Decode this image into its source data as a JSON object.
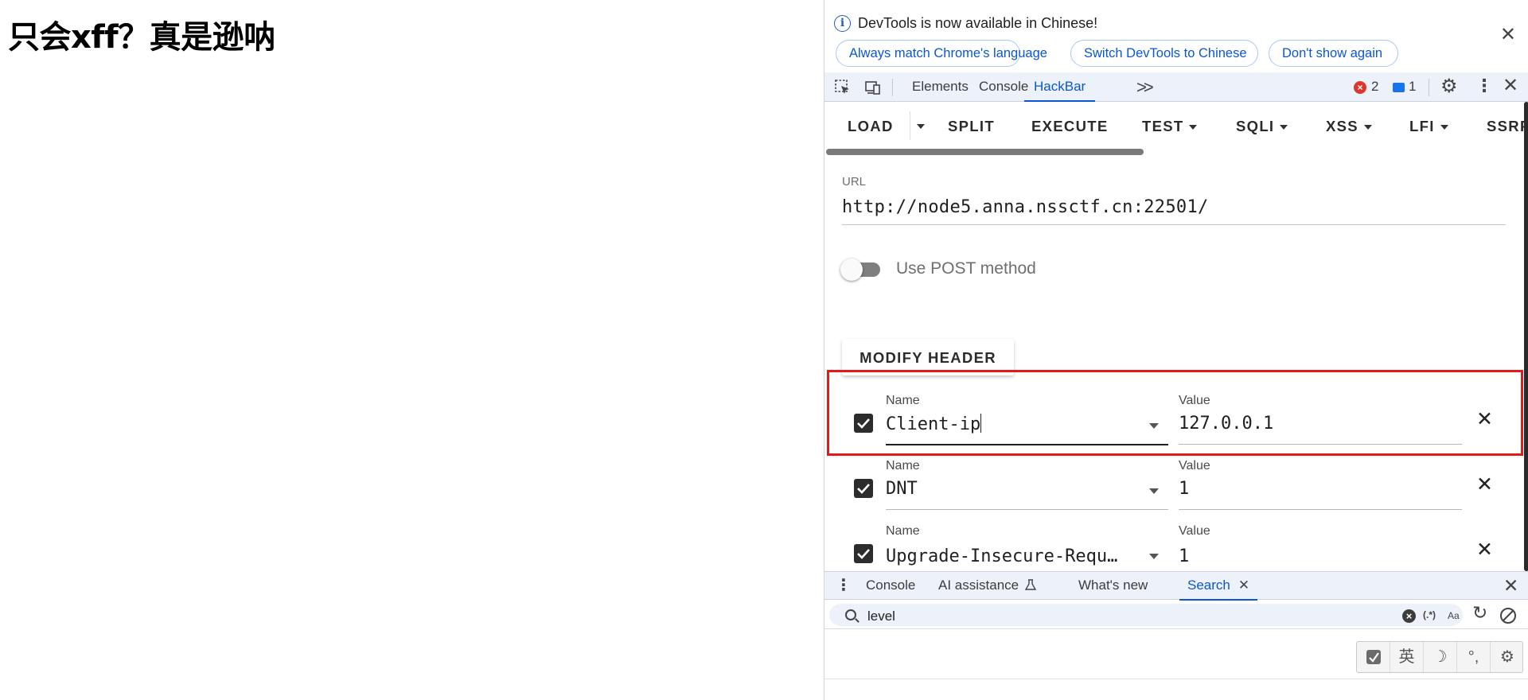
{
  "page": {
    "heading": "只会xff？真是逊呐"
  },
  "infobar": {
    "message": "DevTools is now available in Chinese!",
    "buttons": [
      "Always match Chrome's language",
      "Switch DevTools to Chinese",
      "Don't show again"
    ]
  },
  "tabs": {
    "items": [
      "Elements",
      "Console",
      "HackBar"
    ],
    "active": "HackBar",
    "error_count": "2",
    "message_count": "1"
  },
  "hackbar": {
    "toolbar": {
      "load": "LOAD",
      "split": "SPLIT",
      "execute": "EXECUTE",
      "test": "TEST",
      "sqli": "SQLI",
      "xss": "XSS",
      "lfi": "LFI",
      "ssrf": "SSRF"
    },
    "url_label": "URL",
    "url": "http://node5.anna.nssctf.cn:22501/",
    "post_label": "Use POST method",
    "post_enabled": false,
    "modify_header_label": "MODIFY HEADER",
    "headers": [
      {
        "enabled": true,
        "name_label": "Name",
        "name": "Client-ip",
        "value_label": "Value",
        "value": "127.0.0.1"
      },
      {
        "enabled": true,
        "name_label": "Name",
        "name": "DNT",
        "value_label": "Value",
        "value": "1"
      },
      {
        "enabled": true,
        "name_label": "Name",
        "name": "Upgrade-Insecure-Requ…",
        "value_label": "Value",
        "value": "1"
      }
    ]
  },
  "drawer": {
    "tabs": [
      "Console",
      "AI assistance",
      "What's new",
      "Search"
    ],
    "active": "Search",
    "search_query": "level",
    "regex_label": "(.*)",
    "case_label": "Aa"
  },
  "ime": {
    "lang_label": "英"
  },
  "colors": {
    "accent": "#0b57d0",
    "highlight": "#e41a1a",
    "tabbar_bg": "#edf2fa"
  }
}
